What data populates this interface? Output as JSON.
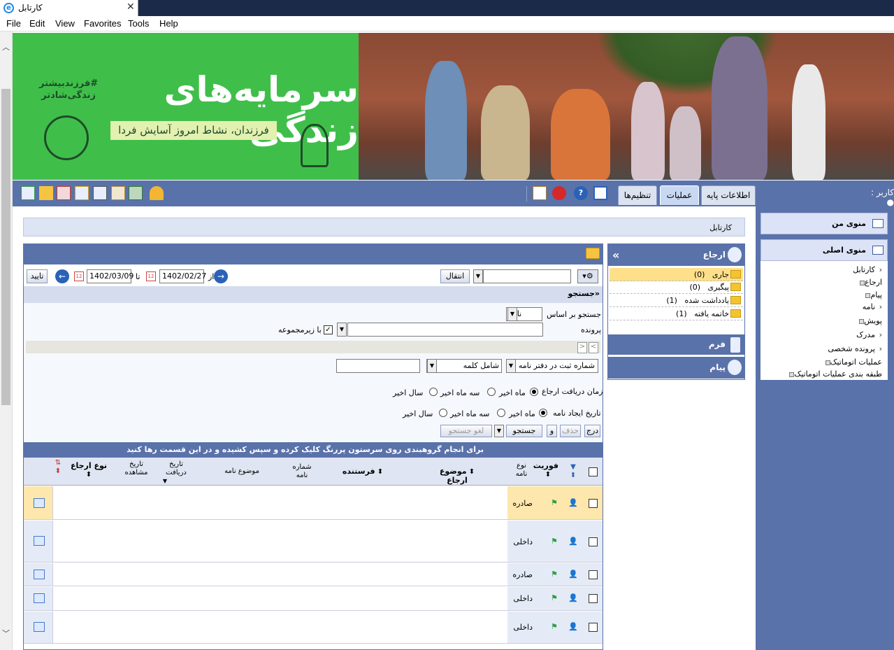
{
  "window": {
    "tab_title": "کارتابل",
    "close": "✕"
  },
  "menu": [
    "File",
    "Edit",
    "View",
    "Favorites",
    "Tools",
    "Help"
  ],
  "banner": {
    "hashtag": "#فرزندبیشتر\nزندگی‌شادتر",
    "title": "سرمایه‌های زندگی",
    "slogan": "فرزندان، نشاط امروز آسایش فردا"
  },
  "toolbar": {
    "user_label": "کاربر :",
    "tabs": [
      "اطلاعات پایه",
      "عملیات",
      "تنظیم‌ها"
    ],
    "active_tab": "عملیات"
  },
  "sidebar": {
    "my_menu": "منوی من",
    "main_menu": "منوی اصلی",
    "items": [
      {
        "label": "کارتابل",
        "kind": "arrow"
      },
      {
        "label": "ارجاع",
        "kind": "box"
      },
      {
        "label": "پیام",
        "kind": "box"
      },
      {
        "label": "نامه",
        "kind": "arrow"
      },
      {
        "label": "پویش",
        "kind": "box"
      },
      {
        "label": "مدرک",
        "kind": "arrow"
      },
      {
        "label": "پرونده شخصی",
        "kind": "arrow"
      },
      {
        "label": "عملیات اتوماتیک",
        "kind": "box"
      },
      {
        "label": "طبقه بندی عملیات اتوماتیک",
        "kind": "box"
      }
    ]
  },
  "breadcrumb": "کارتابل",
  "erja_panel": {
    "title": "ارجاع",
    "items": [
      {
        "label": "جاری",
        "count": "(0)"
      },
      {
        "label": "پیگیری",
        "count": "(0)"
      },
      {
        "label": "یادداشت شده",
        "count": "(1)"
      },
      {
        "label": "خاتمه یافته",
        "count": "(1)"
      }
    ],
    "form": "فرم",
    "message": "پیام"
  },
  "filterbar": {
    "transfer": "انتقال",
    "from": "از",
    "to": "تا",
    "date_from": "1402/02/27",
    "date_to": "1402/03/09",
    "confirm": "تایید"
  },
  "search": {
    "title": "«جستجو",
    "search_by_label": "جستجو بر اساس",
    "search_by_value": "نامه",
    "file_label": "پرونده",
    "subset_label": "با زیرمجموعه",
    "field_value": "شماره ثبت در دفتر نامه",
    "op_value": "شامل کلمه",
    "text_value": "",
    "receive_time_label": "زمان دریافت ارجاع",
    "create_date_label": "تاریخ ایجاد نامه",
    "ranges": [
      "ماه اخیر",
      "سه ماه اخیر",
      "سال اخیر"
    ],
    "btn_insert": "درج",
    "btn_delete": "حذف",
    "btn_and": "و",
    "btn_search": "جستجو",
    "btn_cancel": "لغو جستجو"
  },
  "grid": {
    "group_hint": "برای انجام گروهبندی روی سرستون پررنگ کلیک کرده و سپس کشیده و در این قسمت رها کنید",
    "columns": {
      "priority": "فوریت",
      "letter_type": "نوع\nنامه",
      "subject_erja": "موضوع ارجاع",
      "sender": "فرستنده",
      "letter_number": "شماره\nنامه",
      "letter_subject": "موضوع نامه",
      "receive_date": "تاریخ\nدریافت",
      "view_date": "تاریخ\nمشاهده",
      "erja_type": "نوع ارجاع"
    },
    "rows": [
      {
        "type": "صادره",
        "selected": true
      },
      {
        "type": "داخلی",
        "selected": false
      },
      {
        "type": "صادره",
        "selected": false
      },
      {
        "type": "داخلی",
        "selected": false
      },
      {
        "type": "داخلی",
        "selected": false
      }
    ]
  }
}
